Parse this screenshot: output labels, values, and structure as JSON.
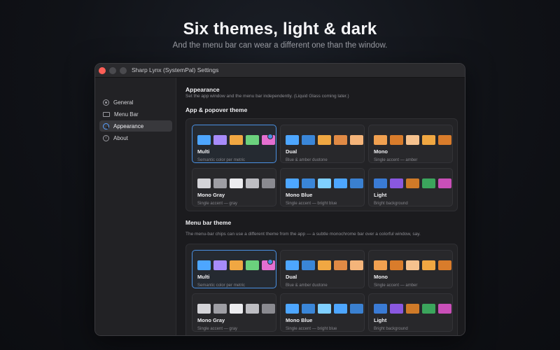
{
  "hero": {
    "title": "Six themes, light & dark",
    "subtitle": "And the menu bar can wear a different one than the window."
  },
  "window": {
    "title": "Sharp Lynx (SystemPal) Settings"
  },
  "sidebar": {
    "items": [
      {
        "label": "General",
        "icon": "general-icon",
        "active": false
      },
      {
        "label": "Menu Bar",
        "icon": "menubar-icon",
        "active": false
      },
      {
        "label": "Appearance",
        "icon": "palette-icon",
        "active": true
      },
      {
        "label": "About",
        "icon": "info-icon",
        "active": false
      }
    ]
  },
  "main": {
    "heading": "Appearance",
    "description": "Set the app window and the menu bar independently. (Liquid Glass coming later.)",
    "app_section": {
      "title": "App & popover theme",
      "selected": "Multi"
    },
    "menubar_section": {
      "title": "Menu bar theme",
      "description": "The menu-bar chips can use a different theme from the app — a subtle monochrome bar over a colorful window, say.",
      "selected": "Multi"
    }
  },
  "themes": [
    {
      "name": "Multi",
      "desc": "Semantic color per metric",
      "colors": [
        "#4da6ff",
        "#a78bfa",
        "#f0a742",
        "#6bd17d",
        "#e46fd0"
      ]
    },
    {
      "name": "Dual",
      "desc": "Blue & amber duotone",
      "colors": [
        "#4da6ff",
        "#3a86d8",
        "#f0a742",
        "#e08a45",
        "#f4b47a"
      ]
    },
    {
      "name": "Mono",
      "desc": "Single accent — amber",
      "colors": [
        "#f0a050",
        "#d97c2b",
        "#f6c28e",
        "#f0a742",
        "#d97c2b"
      ]
    },
    {
      "name": "Mono Gray",
      "desc": "Single accent — gray",
      "colors": [
        "#d4d4d8",
        "#9e9ea4",
        "#ececef",
        "#bdbdc2",
        "#8a8a90"
      ]
    },
    {
      "name": "Mono Blue",
      "desc": "Single accent — bright blue",
      "colors": [
        "#4da6ff",
        "#3a86d8",
        "#7fcfff",
        "#4da6ff",
        "#3a80d0"
      ]
    },
    {
      "name": "Light",
      "desc": "Bright background",
      "colors": [
        "#3a7bd5",
        "#8a58e0",
        "#cf7a28",
        "#3ba55c",
        "#c94fb8"
      ]
    }
  ]
}
